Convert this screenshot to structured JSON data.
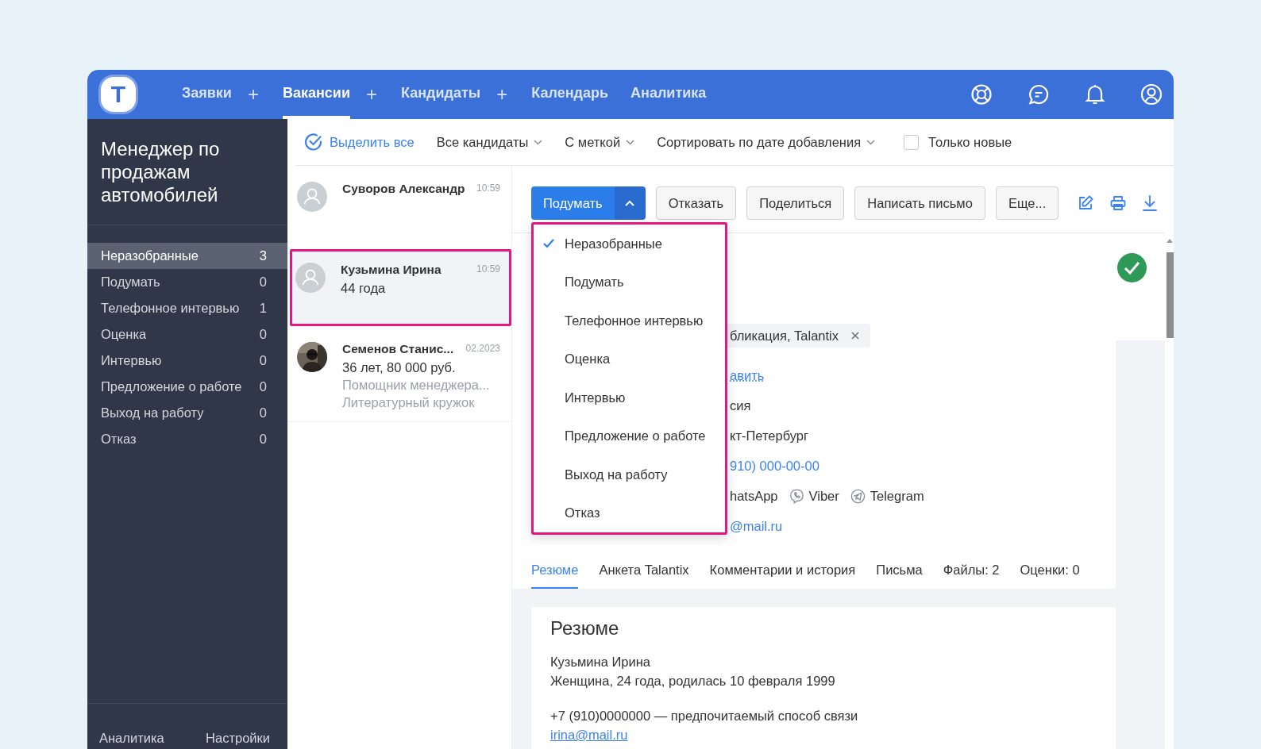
{
  "header": {
    "logo_letter": "T",
    "nav": [
      {
        "label": "Заявки",
        "selected": false,
        "add": "+"
      },
      {
        "label": "Вакансии",
        "selected": true,
        "add": "+"
      },
      {
        "label": "Кандидаты",
        "selected": false,
        "add": "+"
      },
      {
        "label": "Календарь",
        "selected": false
      },
      {
        "label": "Аналитика",
        "selected": false
      }
    ]
  },
  "sidebar": {
    "title": "Менеджер по продажам автомобилей",
    "stages": [
      {
        "label": "Неразобранные",
        "count": "3",
        "selected": true
      },
      {
        "label": "Подумать",
        "count": "0",
        "selected": false
      },
      {
        "label": "Телефонное интервью",
        "count": "1",
        "selected": false
      },
      {
        "label": "Оценка",
        "count": "0",
        "selected": false
      },
      {
        "label": "Интервью",
        "count": "0",
        "selected": false
      },
      {
        "label": "Предложение о работе",
        "count": "0",
        "selected": false
      },
      {
        "label": "Выход на работу",
        "count": "0",
        "selected": false
      },
      {
        "label": "Отказ",
        "count": "0",
        "selected": false
      }
    ],
    "footer": [
      "Аналитика",
      "Настройки"
    ]
  },
  "toolbar": {
    "select_all": "Выделить все",
    "filters": [
      "Все кандидаты",
      "С меткой",
      "Сортировать по дате добавления"
    ],
    "only_new": {
      "label": "Только новые",
      "checked": false
    }
  },
  "candidates": [
    {
      "name": "Суворов Александр",
      "time": "10:59",
      "kind": "placeholder",
      "selected": false
    },
    {
      "name": "Кузьмина Ирина",
      "time": "10:59",
      "kind": "placeholder",
      "selected": true,
      "subtitle": "44 года"
    },
    {
      "name": "Семенов Станис...",
      "time": "02.2023",
      "selected": false,
      "subtitle": "36 лет, 80 000 руб.",
      "notes": [
        "Помощник менеджера...",
        "Литературный кружок"
      ]
    }
  ],
  "actions": {
    "primary": {
      "label": "Подумать",
      "expanded": true
    },
    "buttons": [
      "Отказать",
      "Поделиться",
      "Написать письмо",
      "Еще..."
    ]
  },
  "stage_menu": [
    {
      "label": "Неразобранные",
      "selected": true
    },
    {
      "label": "Подумать",
      "selected": false
    },
    {
      "label": "Телефонное интервью",
      "selected": false
    },
    {
      "label": "Оценка",
      "selected": false
    },
    {
      "label": "Интервью",
      "selected": false
    },
    {
      "label": "Предложение о работе",
      "selected": false
    },
    {
      "label": "Выход на работу",
      "selected": false
    },
    {
      "label": "Отказ",
      "selected": false
    }
  ],
  "profile": {
    "tag": "бликация, Talantix",
    "link": "авить",
    "country": "сия",
    "city": "кт-Петербург",
    "phone": "910) 000-00-00",
    "messengers": [
      {
        "label": "hatsApp",
        "kind": "whatsapp"
      },
      {
        "label": "Viber",
        "kind": "viber"
      },
      {
        "label": "Telegram",
        "kind": "telegram"
      }
    ],
    "email": "@mail.ru"
  },
  "detail_tabs": [
    {
      "label": "Резюме",
      "selected": true
    },
    {
      "label": "Анкета Talantix",
      "selected": false
    },
    {
      "label": "Комментарии и история",
      "selected": false
    },
    {
      "label": "Письма",
      "selected": false
    },
    {
      "label": "Файлы: 2",
      "selected": false
    },
    {
      "label": "Оценки: 0",
      "selected": false
    }
  ],
  "resume": {
    "title": "Резюме",
    "lines": [
      "Кузьмина Ирина",
      "Женщина, 24 года, родилась 10 февраля 1999"
    ],
    "contact": "+7 (910)0000000 — предпочитаемый способ связи",
    "email": "irina@mail.ru"
  }
}
